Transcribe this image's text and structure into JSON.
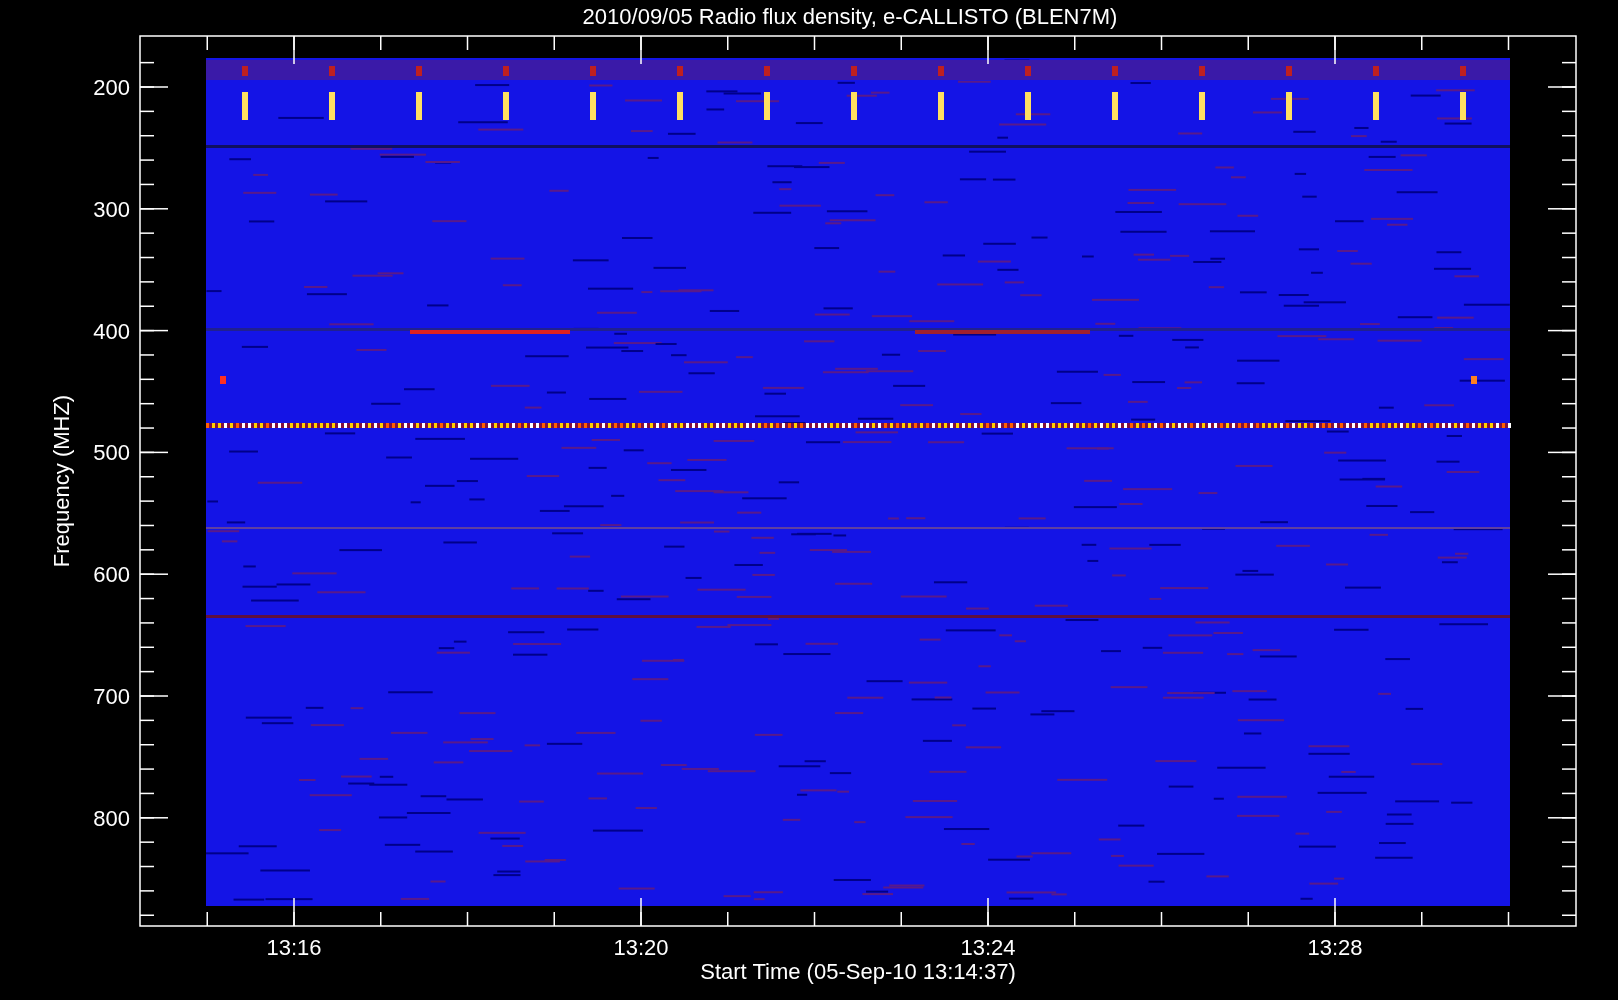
{
  "title": "2010/09/05  Radio flux density, e-CALLISTO (BLEN7M)",
  "y_axis": {
    "label": "Frequency (MHZ)",
    "ticks": [
      "200",
      "300",
      "400",
      "500",
      "600",
      "700",
      "800"
    ]
  },
  "x_axis": {
    "label": "Start Time (05-Sep-10 13:14:37)",
    "ticks": [
      "13:16",
      "13:20",
      "13:24",
      "13:28"
    ]
  }
}
